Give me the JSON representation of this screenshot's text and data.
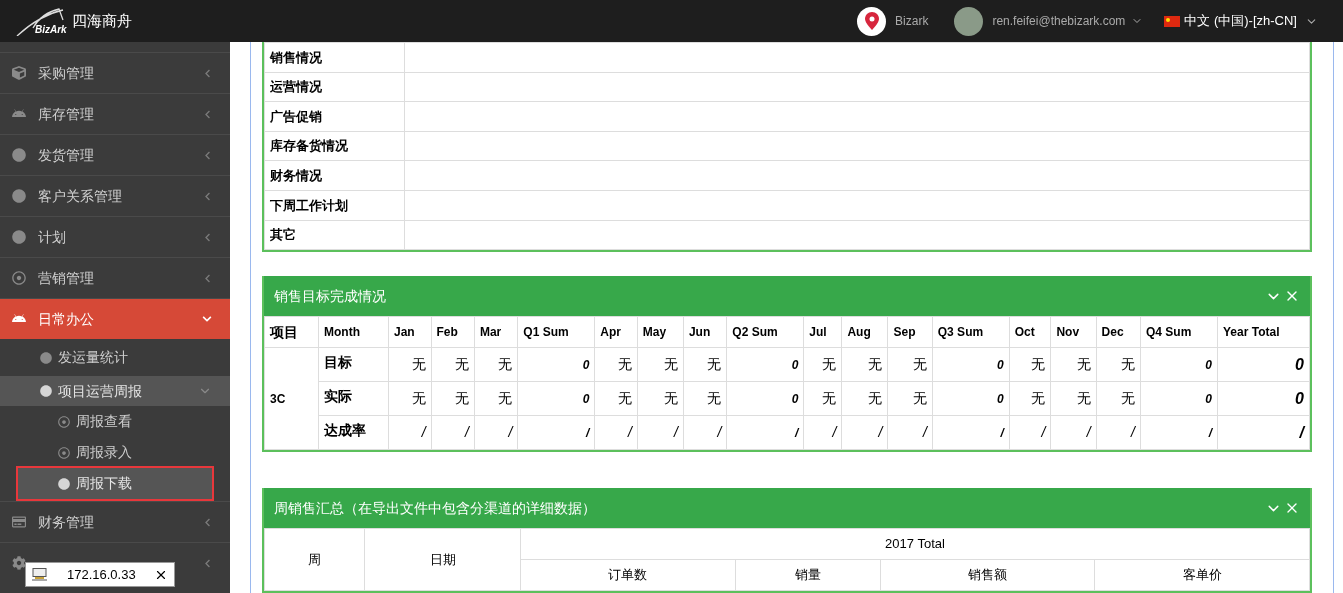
{
  "top_bar": {
    "logo_text": "BizArk",
    "brand": "四海商舟",
    "company": "Bizark",
    "user": "ren.feifei@thebizark.com",
    "language": "中文 (中国)-[zh-CN]"
  },
  "sidebar": {
    "items": [
      {
        "label": "采购管理",
        "expanded": false,
        "selected": false
      },
      {
        "label": "库存管理",
        "expanded": false,
        "selected": false
      },
      {
        "label": "发货管理",
        "expanded": false,
        "selected": false
      },
      {
        "label": "客户关系管理",
        "expanded": false,
        "selected": false
      },
      {
        "label": "计划",
        "expanded": false,
        "selected": false
      },
      {
        "label": "营销管理",
        "expanded": false,
        "selected": false
      },
      {
        "label": "日常办公",
        "expanded": true,
        "selected": true,
        "children": [
          {
            "label": "发运量统计",
            "selected": false
          },
          {
            "label": "项目运营周报",
            "expanded": true,
            "selected": true,
            "children": [
              {
                "label": "周报查看",
                "selected": false
              },
              {
                "label": "周报录入",
                "selected": false
              },
              {
                "label": "周报下载",
                "selected": true
              }
            ]
          }
        ]
      },
      {
        "label": "财务管理",
        "expanded": false,
        "selected": false
      },
      {
        "expanded": false,
        "selected": false
      }
    ]
  },
  "ip_tooltip": {
    "text": "172.16.0.33"
  },
  "report_sections": {
    "rows": [
      "销售情况",
      "运营情况",
      "广告促销",
      "库存备货情况",
      "财务情况",
      "下周工作计划",
      "其它"
    ]
  },
  "sales_target_panel": {
    "title": "销售目标完成情况",
    "columns": [
      {
        "label": "项目",
        "kind": "item"
      },
      {
        "label": "Month",
        "kind": "label"
      },
      {
        "label": "Jan",
        "kind": "month"
      },
      {
        "label": "Feb",
        "kind": "month"
      },
      {
        "label": "Mar",
        "kind": "month"
      },
      {
        "label": "Q1 Sum",
        "kind": "sum"
      },
      {
        "label": "Apr",
        "kind": "month"
      },
      {
        "label": "May",
        "kind": "month"
      },
      {
        "label": "Jun",
        "kind": "month"
      },
      {
        "label": "Q2 Sum",
        "kind": "sum"
      },
      {
        "label": "Jul",
        "kind": "month"
      },
      {
        "label": "Aug",
        "kind": "month"
      },
      {
        "label": "Sep",
        "kind": "month"
      },
      {
        "label": "Q3 Sum",
        "kind": "sum"
      },
      {
        "label": "Oct",
        "kind": "month"
      },
      {
        "label": "Nov",
        "kind": "month"
      },
      {
        "label": "Dec",
        "kind": "month"
      },
      {
        "label": "Q4 Sum",
        "kind": "sum"
      },
      {
        "label": "Year Total",
        "kind": "total"
      }
    ],
    "group": "3C",
    "rows": [
      {
        "label": "目标",
        "kind": "value",
        "values": [
          "无",
          "无",
          "无",
          "0",
          "无",
          "无",
          "无",
          "0",
          "无",
          "无",
          "无",
          "0",
          "无",
          "无",
          "无",
          "0",
          "0"
        ]
      },
      {
        "label": "实际",
        "kind": "value",
        "values": [
          "无",
          "无",
          "无",
          "0",
          "无",
          "无",
          "无",
          "0",
          "无",
          "无",
          "无",
          "0",
          "无",
          "无",
          "无",
          "0",
          "0"
        ]
      },
      {
        "label": "达成率",
        "kind": "rate",
        "values": [
          "/",
          "/",
          "/",
          "/",
          "/",
          "/",
          "/",
          "/",
          "/",
          "/",
          "/",
          "/",
          "/",
          "/",
          "/",
          "/",
          "/"
        ]
      }
    ]
  },
  "weekly_sales_panel": {
    "title": "周销售汇总（在导出文件中包含分渠道的详细数据）",
    "week_header": "周",
    "date_header": "日期",
    "group_header": "2017 Total",
    "columns": [
      "订单数",
      "销量",
      "销售额",
      "客单价"
    ]
  }
}
